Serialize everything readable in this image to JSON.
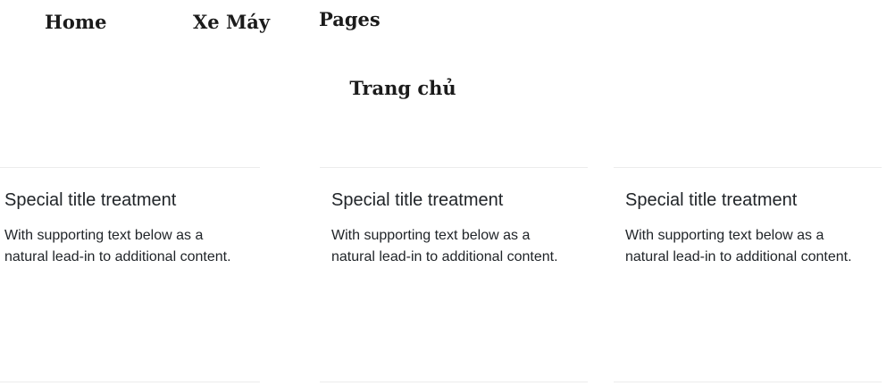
{
  "nav": {
    "items": [
      {
        "label": "Home"
      },
      {
        "label": "Xe Máy"
      },
      {
        "label": "Pages"
      }
    ]
  },
  "page_title": "Trang chủ",
  "cards": [
    {
      "title": "Special title treatment",
      "text": "With supporting text below as a natural lead-in to additional content."
    },
    {
      "title": "Special title treatment",
      "text": "With supporting text below as a natural lead-in to additional content."
    },
    {
      "title": "Special title treatment",
      "text": "With supporting text below as a natural lead-in to additional content."
    }
  ]
}
